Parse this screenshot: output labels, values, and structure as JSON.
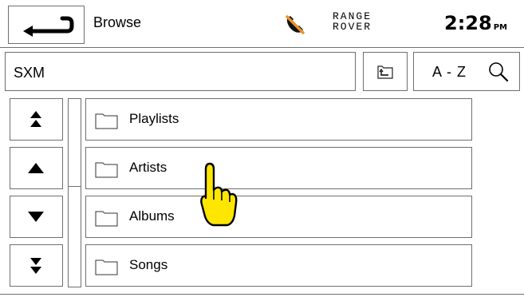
{
  "header": {
    "title": "Browse",
    "brand_line1": "RANGE",
    "brand_line2": "ROVER",
    "time": "2:28",
    "ampm": "PM"
  },
  "source": {
    "label": "SXM",
    "sort_label": "A - Z"
  },
  "list": {
    "items": [
      {
        "label": "Playlists"
      },
      {
        "label": "Artists"
      },
      {
        "label": "Albums"
      },
      {
        "label": "Songs"
      }
    ]
  },
  "icons": {
    "back": "back-arrow-icon",
    "phone": "phone-disconnected-icon",
    "up_level": "up-level-folder-icon",
    "search": "search-icon",
    "page_up": "double-up-arrow-icon",
    "line_up": "up-arrow-icon",
    "line_down": "down-arrow-icon",
    "page_down": "double-down-arrow-icon",
    "folder": "folder-icon",
    "pointer": "hand-pointer-icon"
  },
  "colors": {
    "pointer_fill": "#ffe600",
    "phone_slash": "#e8942a",
    "border": "#6f6f6f"
  }
}
